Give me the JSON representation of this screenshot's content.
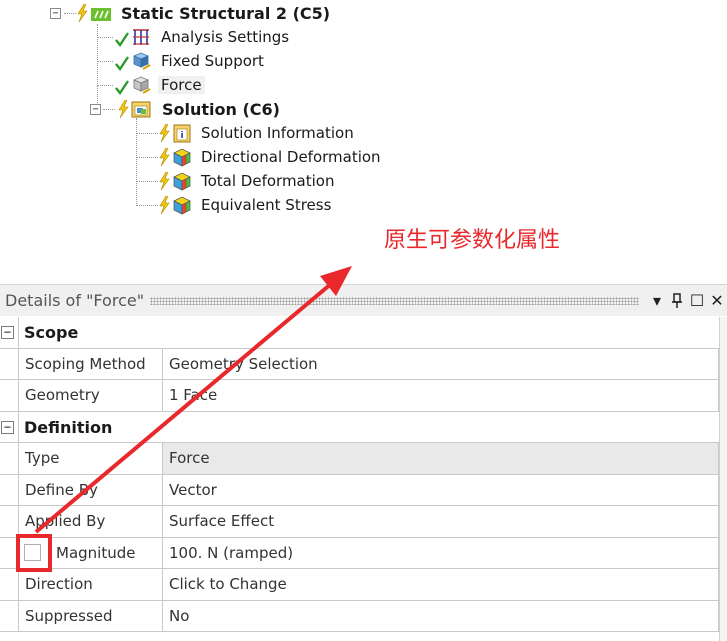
{
  "tree": {
    "nodes": [
      {
        "label": "Static Structural 2 (C5)",
        "icon": "static-structural-icon",
        "status": "lightning-bolt"
      },
      {
        "label": "Analysis Settings",
        "icon": "analysis-settings-icon",
        "status": "checkmark"
      },
      {
        "label": "Fixed Support",
        "icon": "fixed-support-icon",
        "status": "checkmark"
      },
      {
        "label": "Force",
        "icon": "force-icon",
        "status": "checkmark"
      },
      {
        "label": "Solution (C6)",
        "icon": "solution-icon",
        "status": "lightning-bolt"
      },
      {
        "label": "Solution Information",
        "icon": "solution-information-icon",
        "status": "lightning-bolt"
      },
      {
        "label": "Directional Deformation",
        "icon": "result-cube-icon",
        "status": "lightning-bolt"
      },
      {
        "label": "Total Deformation",
        "icon": "result-cube-icon",
        "status": "lightning-bolt"
      },
      {
        "label": "Equivalent Stress",
        "icon": "result-cube-icon",
        "status": "lightning-bolt"
      }
    ]
  },
  "annotation": {
    "text": "原生可参数化属性",
    "color": "#e8282b"
  },
  "details": {
    "title": "Details of \"Force\"",
    "buttons": {
      "dropdown": "▾",
      "pin": "📌",
      "maximize": "☐",
      "close": "✕"
    },
    "groups": [
      {
        "label": "Scope",
        "properties": [
          {
            "name": "Scoping Method",
            "value": "Geometry Selection"
          },
          {
            "name": "Geometry",
            "value": "1 Face"
          }
        ]
      },
      {
        "label": "Definition",
        "properties": [
          {
            "name": "Type",
            "value": "Force"
          },
          {
            "name": "Define By",
            "value": "Vector"
          },
          {
            "name": "Applied By",
            "value": "Surface Effect"
          },
          {
            "name": "Magnitude",
            "value": "100. N  (ramped)"
          },
          {
            "name": "Direction",
            "value": "Click to Change"
          },
          {
            "name": "Suppressed",
            "value": "No"
          }
        ]
      }
    ]
  }
}
